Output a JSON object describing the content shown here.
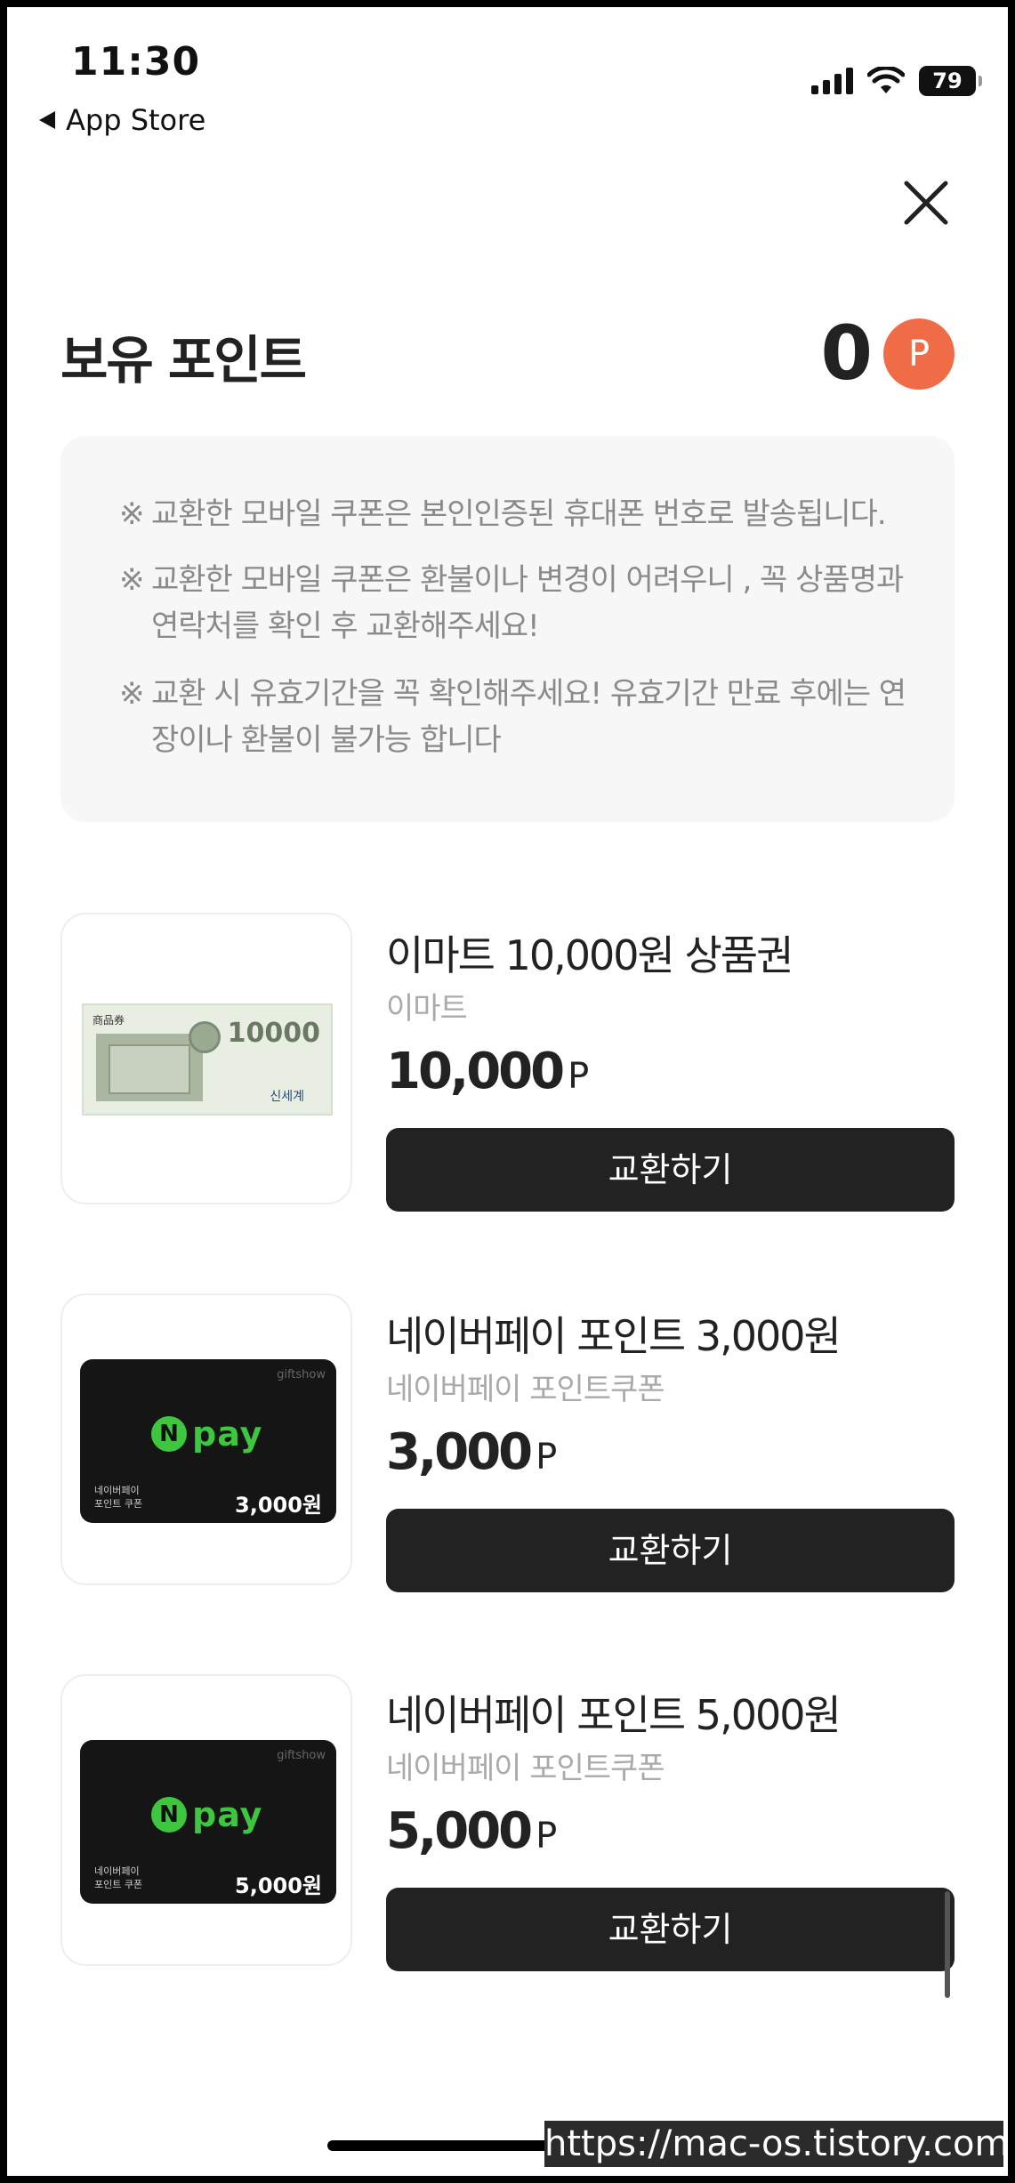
{
  "status_bar": {
    "time": "11:30",
    "back_label": "App Store",
    "battery": "79"
  },
  "points": {
    "title": "보유 포인트",
    "value": "0",
    "badge": "P"
  },
  "notices": [
    {
      "mark": "※",
      "text": "교환한 모바일 쿠폰은 본인인증된 휴대폰 번호로 발송됩니다."
    },
    {
      "mark": "※",
      "text": "교환한 모바일 쿠폰은 환불이나 변경이 어려우니 , 꼭 상품명과 연락처를 확인 후 교환해주세요!"
    },
    {
      "mark": "※",
      "text": "교환 시 유효기간을 꼭 확인해주세요! 유효기간 만료 후에는 연장이나 환불이 불가능 합니다"
    }
  ],
  "items": [
    {
      "title": "이마트 10,000원 상품권",
      "brand": "이마트",
      "price": "10,000",
      "unit": "P",
      "button": "교환하기",
      "image": {
        "type": "voucher",
        "amount": "10000",
        "brand_mark": "신세계",
        "label": "商品券"
      }
    },
    {
      "title": "네이버페이 포인트 3,000원",
      "brand": "네이버페이 포인트쿠폰",
      "price": "3,000",
      "unit": "P",
      "button": "교환하기",
      "image": {
        "type": "npay",
        "logo_n": "N",
        "logo_text": "pay",
        "tag": "giftshow",
        "sub1": "네이버페이",
        "sub2": "포인트 쿠폰",
        "amount": "3,000원"
      }
    },
    {
      "title": "네이버페이 포인트 5,000원",
      "brand": "네이버페이 포인트쿠폰",
      "price": "5,000",
      "unit": "P",
      "button": "교환하기",
      "image": {
        "type": "npay",
        "logo_n": "N",
        "logo_text": "pay",
        "tag": "giftshow",
        "sub1": "네이버페이",
        "sub2": "포인트 쿠폰",
        "amount": "5,000원"
      }
    }
  ],
  "watermark": "https://mac-os.tistory.com",
  "colors": {
    "badge": "#ef6c47",
    "button": "#222222",
    "npay_green": "#3ec640",
    "notice_bg": "#f7f7f7"
  }
}
